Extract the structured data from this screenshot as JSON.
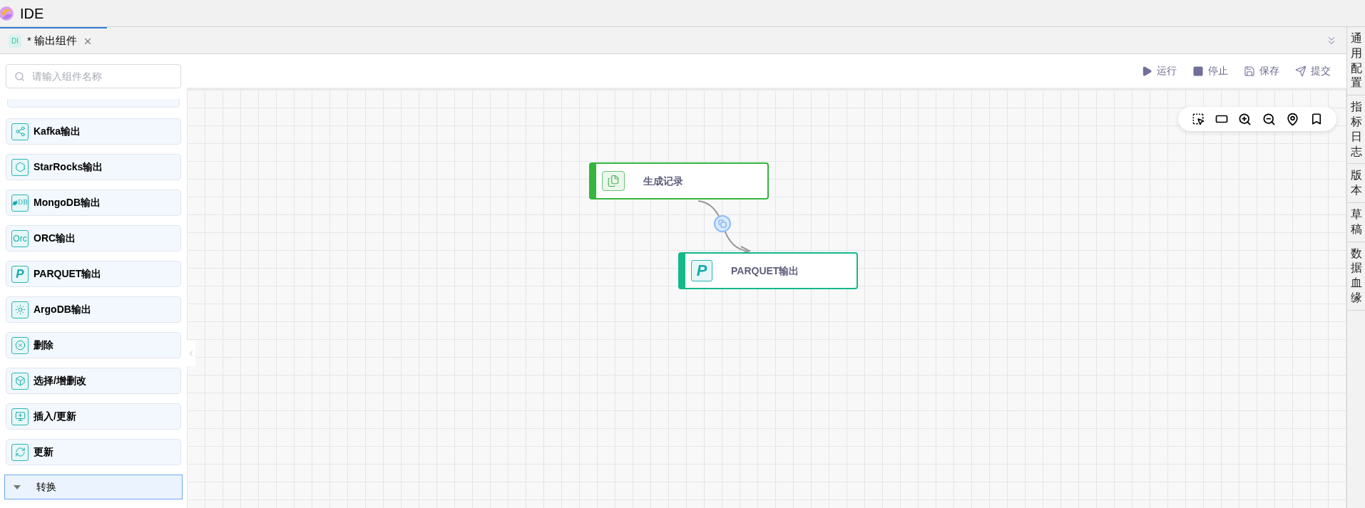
{
  "app": {
    "title": "IDE"
  },
  "tabs": [
    {
      "badge": "DI",
      "label": "* 输出组件",
      "selected": true
    }
  ],
  "search": {
    "placeholder": "请输入组件名称"
  },
  "components": [
    {
      "label": "Kafka输出",
      "kind": "kafka"
    },
    {
      "label": "StarRocks输出",
      "kind": "starrocks"
    },
    {
      "label": "MongoDB输出",
      "kind": "mongodb",
      "icon_text": "DB"
    },
    {
      "label": "ORC输出",
      "kind": "text",
      "icon_text": "Orc"
    },
    {
      "label": "PARQUET输出",
      "kind": "letter",
      "icon_text": "P"
    },
    {
      "label": "ArgoDB输出",
      "kind": "argodb"
    },
    {
      "label": "删除",
      "kind": "delete"
    },
    {
      "label": "选择/增删改",
      "kind": "select"
    },
    {
      "label": "插入/更新",
      "kind": "insert"
    },
    {
      "label": "更新",
      "kind": "update"
    }
  ],
  "category": {
    "label": "转换",
    "selected": true
  },
  "actions": [
    {
      "label": "运行",
      "kind": "run"
    },
    {
      "label": "停止",
      "kind": "stop"
    },
    {
      "label": "保存",
      "kind": "save"
    },
    {
      "label": "提交",
      "kind": "submit"
    }
  ],
  "nodes": [
    {
      "label": "生成记录",
      "kind": "generate",
      "color": "#35b53e"
    },
    {
      "label": "PARQUET输出",
      "kind": "letter",
      "icon_text": "P",
      "color": "#14b88a"
    }
  ],
  "side_tabs": [
    "通用配置",
    "指标日志",
    "版本",
    "草稿",
    "数据血缘"
  ]
}
